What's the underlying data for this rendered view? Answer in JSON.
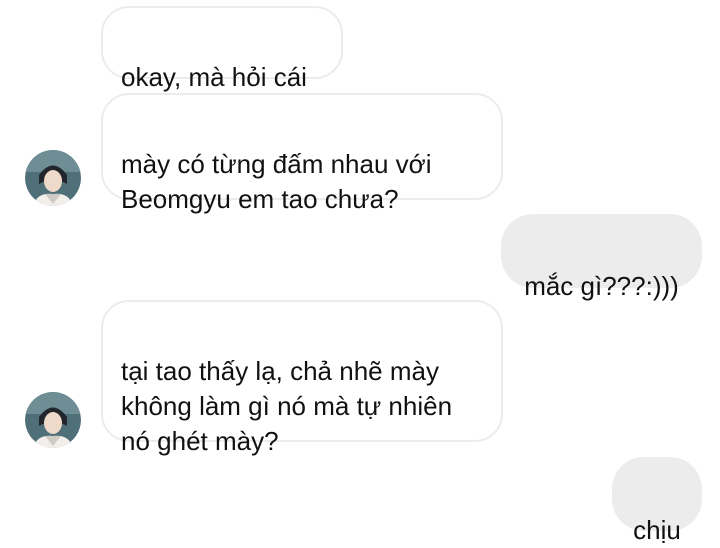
{
  "messages": [
    {
      "from": "them",
      "text": "okay, mà hỏi cái"
    },
    {
      "from": "them",
      "text": "mày có từng đấm nhau với Beomgyu em tao chưa?"
    },
    {
      "from": "me",
      "text": "mắc gì???:)))"
    },
    {
      "from": "them",
      "text": "tại tao thấy lạ, chả nhẽ mày không làm gì nó mà tự nhiên nó ghét mày?"
    },
    {
      "from": "me",
      "text": "chịu"
    }
  ],
  "colors": {
    "outgoing_bubble": "#ececec",
    "incoming_border": "#ececec",
    "text": "#111111"
  },
  "icons": {
    "avatar": "contact-avatar-photo"
  }
}
